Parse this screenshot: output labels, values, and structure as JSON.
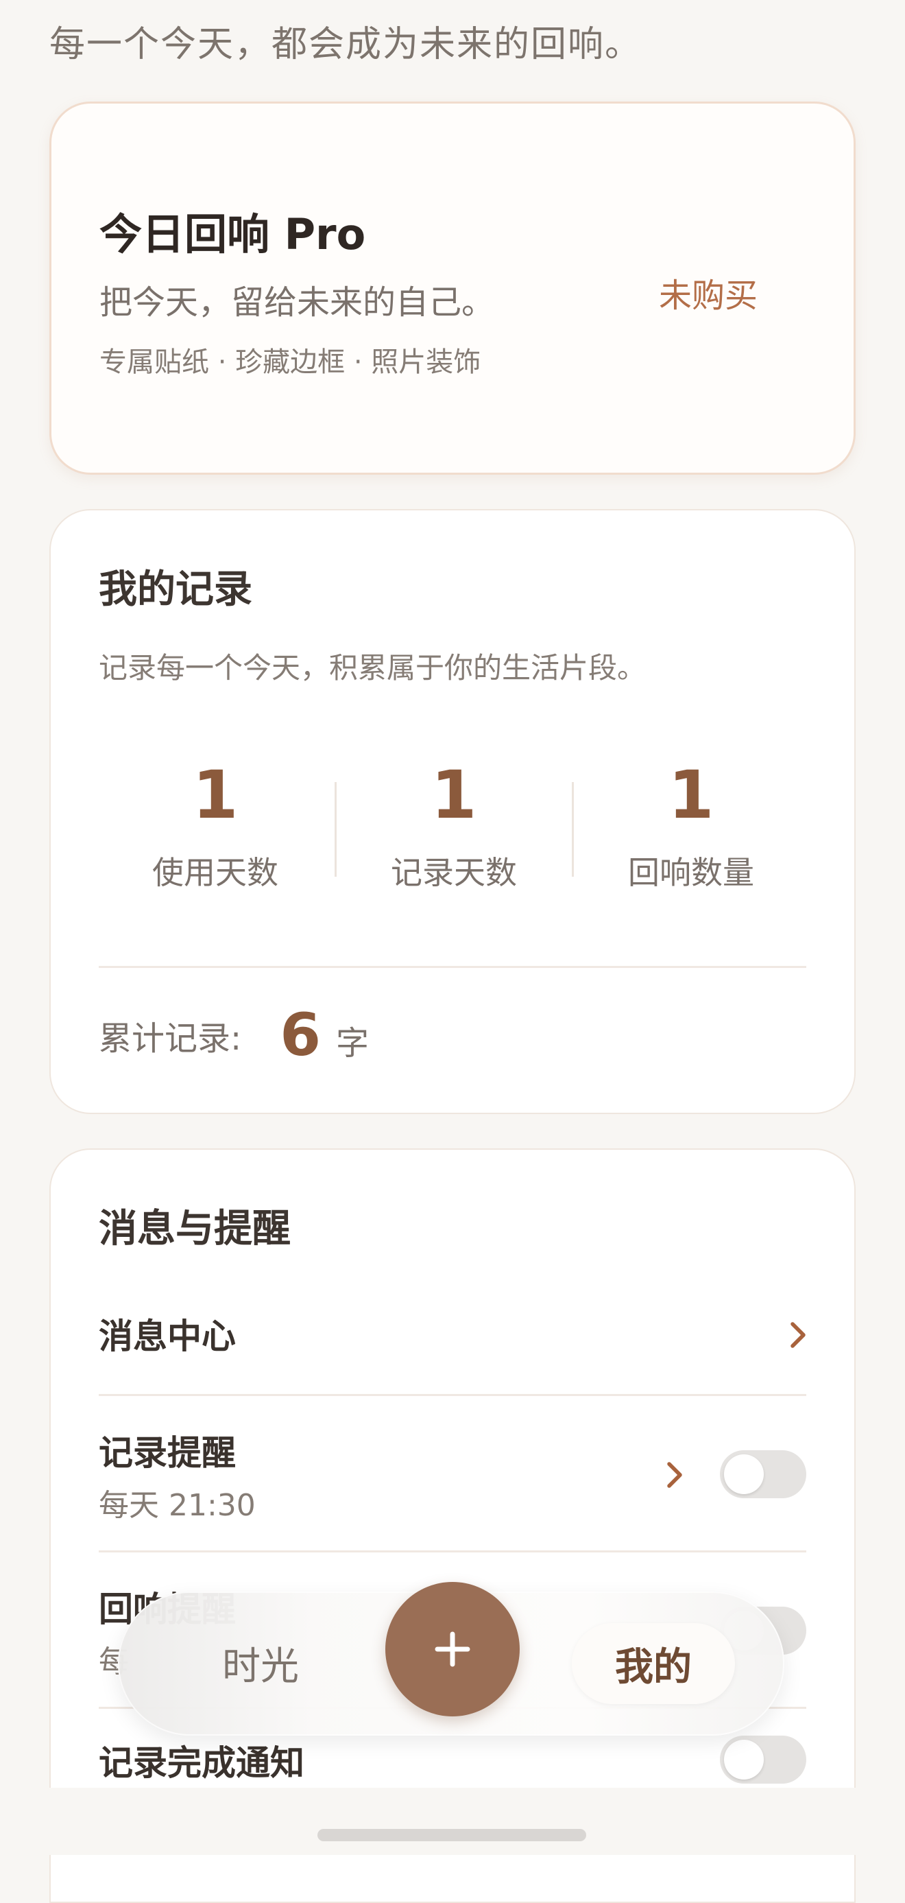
{
  "header": {
    "tagline": "每一个今天，都会成为未来的回响。"
  },
  "pro_card": {
    "title": "今日回响 Pro",
    "subtitle": "把今天，留给未来的自己。",
    "features": "专属贴纸 · 珍藏边框 · 照片装饰",
    "status": "未购买"
  },
  "records": {
    "title": "我的记录",
    "description": "记录每一个今天，积累属于你的生活片段。",
    "stats": [
      {
        "value": "1",
        "label": "使用天数"
      },
      {
        "value": "1",
        "label": "记录天数"
      },
      {
        "value": "1",
        "label": "回响数量"
      }
    ],
    "total_label": "累计记录:",
    "total_value": "6",
    "total_unit": "字"
  },
  "messages": {
    "title": "消息与提醒",
    "message_center": {
      "label": "消息中心"
    },
    "record_reminder": {
      "label": "记录提醒",
      "time": "每天 21:30",
      "enabled": false
    },
    "echo_reminder": {
      "label": "回响提醒",
      "sub": "每",
      "enabled": false
    },
    "completion_notice": {
      "label": "记录完成通知",
      "enabled": false
    }
  },
  "tab_bar": {
    "time_tab": "时光",
    "add_icon": "plus-icon",
    "mine_tab": "我的",
    "active_tab": "我的"
  },
  "colors": {
    "accent": "#8b5a3c",
    "status_orange": "#b36e48",
    "add_button": "#9a6e55",
    "background": "#f8f6f3"
  }
}
